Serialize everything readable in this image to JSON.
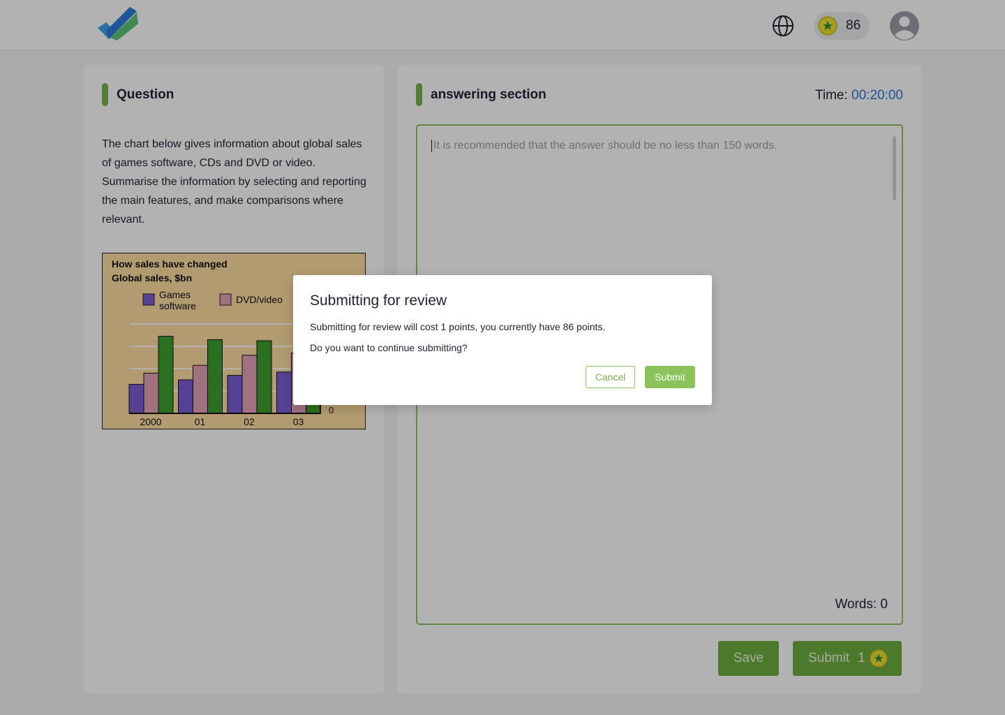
{
  "header": {
    "points": "86"
  },
  "question": {
    "title": "Question",
    "text": "The chart below gives information about global sales of games software, CDs and DVD or video. Summarise the information by selecting and reporting the main features, and make comparisons where relevant."
  },
  "chart_data": {
    "type": "bar",
    "title": "How sales have changed",
    "subtitle": "Global sales, $bn",
    "categories": [
      "2000",
      "01",
      "02",
      "03"
    ],
    "series": [
      {
        "name": "Games software",
        "values": [
          2.6,
          3.0,
          3.4,
          3.7
        ],
        "color": "#7b5fd6"
      },
      {
        "name": "DVD/video",
        "values": [
          3.6,
          4.3,
          5.2,
          5.4
        ],
        "color": "#e6a2b8"
      },
      {
        "name": "",
        "values": [
          6.9,
          6.6,
          6.5,
          6.2
        ],
        "color": "#3ea02e"
      }
    ],
    "y_tick_labels": [
      "0"
    ],
    "ylim": [
      0,
      8
    ],
    "grid": true,
    "legend": "top"
  },
  "answer": {
    "title": "answering section",
    "time_label": "Time:",
    "time_value": "00:20:00",
    "placeholder": "It is recommended that the answer should be no less than 150 words.",
    "words_label": "Words: 0",
    "save_label": "Save",
    "submit_label": "Submit",
    "submit_cost": "1"
  },
  "modal": {
    "title": "Submitting for review",
    "message": "Submitting for review will cost 1 points, you currently have 86 points.",
    "question": "Do you want to continue submitting?",
    "cancel_label": "Cancel",
    "submit_label": "Submit"
  },
  "colors": {
    "accent": "#76b34b",
    "timer": "#2b74d8",
    "coin": "#d6d020"
  }
}
